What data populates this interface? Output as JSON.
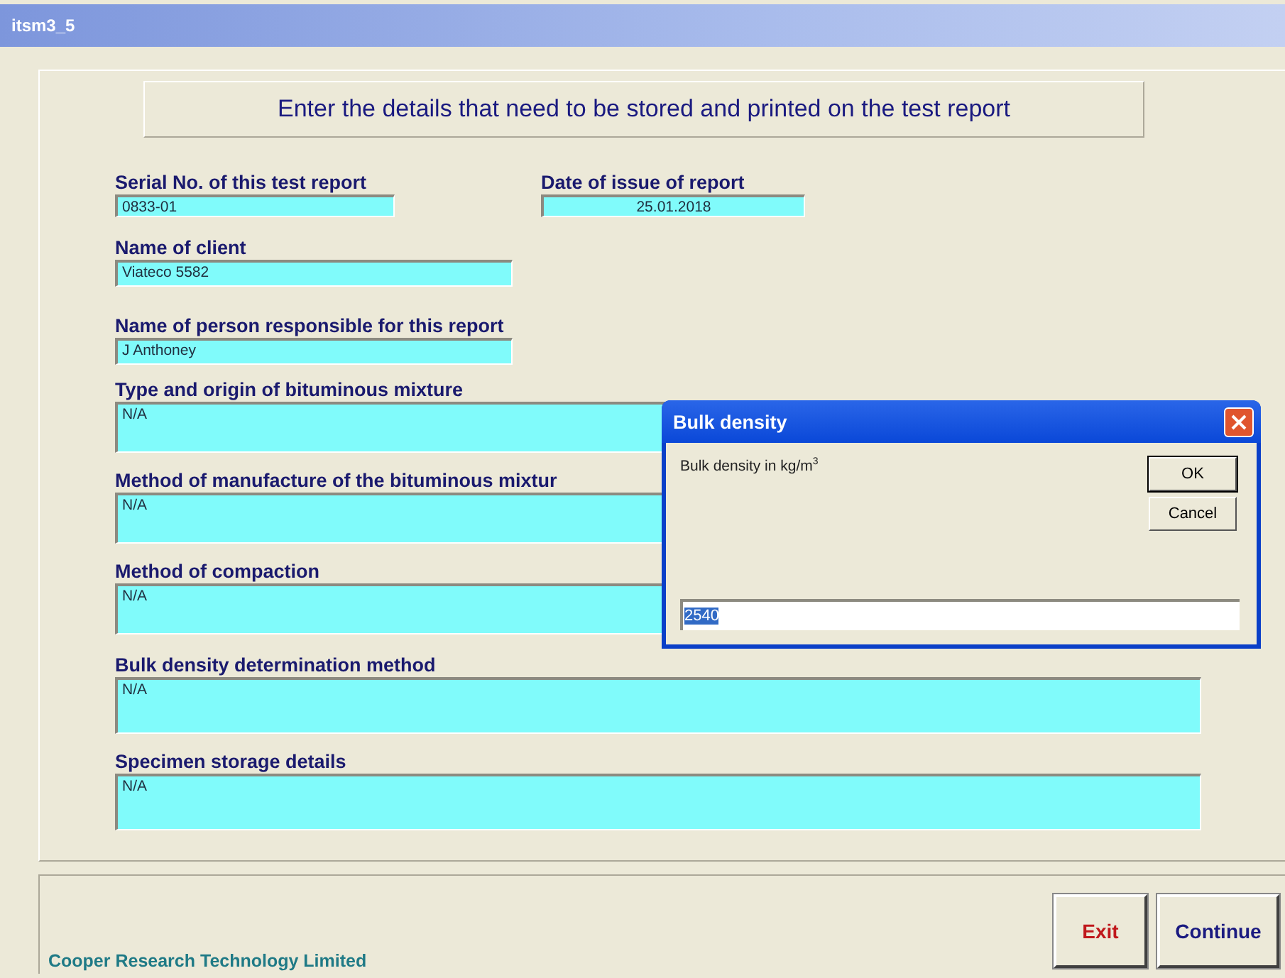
{
  "window": {
    "title": "itsm3_5"
  },
  "heading": "Enter the details that need to be stored and printed on the test report",
  "top_fields": [
    {
      "label": "Serial No. of this test report",
      "value": "0833-01"
    },
    {
      "label": "Date of issue of report",
      "value": "25.01.2018"
    }
  ],
  "short_fields": [
    {
      "label": "Name of client",
      "value": "Viateco 5582"
    },
    {
      "label": "Name of person responsible for this report",
      "value": "J Anthoney"
    }
  ],
  "long_fields": [
    {
      "label": "Type and origin of bituminous mixture",
      "value": "N/A"
    },
    {
      "label": "Method of manufacture of the bituminous mixtur",
      "value": "N/A"
    },
    {
      "label": "Method of compaction",
      "value": "N/A"
    },
    {
      "label": "Bulk density determination method",
      "value": "N/A"
    },
    {
      "label": "Specimen storage details",
      "value": "N/A"
    }
  ],
  "footer": {
    "company": "Cooper Research Technology Limited",
    "buttons": [
      {
        "label": "Exit",
        "kind": "exit"
      },
      {
        "label": "Continue",
        "kind": "continue"
      }
    ]
  },
  "dialog": {
    "title": "Bulk density",
    "prompt": "Bulk density in kg/m$^{3}$",
    "buttons": [
      "OK",
      "Cancel"
    ],
    "value": "2540",
    "value_selected": true
  }
}
